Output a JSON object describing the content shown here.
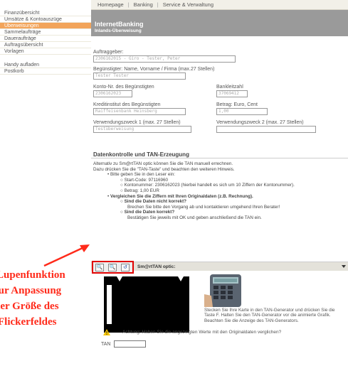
{
  "topnav": {
    "items": [
      "Homepage",
      "Banking",
      "Service & Verwaltung"
    ]
  },
  "sidebar": {
    "items": [
      "Finanzübersicht",
      "Umsätze & Kontoauszüge",
      "Überweisungen",
      "Sammelaufträge",
      "Daueraufträge",
      "Auftragsübersicht",
      "Vorlagen"
    ],
    "active_index": 2,
    "items2": [
      "Handy aufladen",
      "Postkorb"
    ]
  },
  "banner": {
    "title": "InternetBanking",
    "subtitle": "Inlands-Überweisung"
  },
  "form": {
    "auftraggeber": {
      "label": "Auftraggeber:",
      "value": "2306162015 - Giro - Tester, Peter"
    },
    "beguenstigter": {
      "label": "Begünstigter: Name, Vorname / Firma (max.27 Stellen)",
      "value": "Tester Tester"
    },
    "kontonr": {
      "label": "Konto-Nr. des Begünstigten",
      "value": "2306162023"
    },
    "bankleitzahl": {
      "label": "Bankleitzahl",
      "value": "37069412"
    },
    "kreditinstitut": {
      "label": "Kreditinstitut des Begünstigten",
      "value": "Raiffeisenbank Heinsberg"
    },
    "betrag": {
      "label": "Betrag: Euro, Cent",
      "value": "1,00"
    },
    "zweck1": {
      "label": "Verwendungszweck 1 (max. 27 Stellen)",
      "value": "Testüberweisung"
    },
    "zweck2": {
      "label": "Verwendungszweck 2 (max. 27 Stellen)",
      "value": ""
    }
  },
  "tan": {
    "heading": "Datenkontrolle und TAN-Erzeugung",
    "intro1": "Alternativ zu Sm@rtTAN optic können Sie die TAN manuell errechnen.",
    "intro2": "Dazu drücken Sie die \"TAN-Taste\" und beachten den weiteren Hinweis.",
    "step1": "Bitte geben Sie in den Leser ein:",
    "startcode": "Start-Code: 97116960",
    "kontonummer": "Kontonummer: 2306162023 (hierbei handelt es sich um 10 Ziffern der Kontonummer).",
    "betrag": "Betrag: 1,00 EUR",
    "step2": "Vergleichen Sie die Ziffern mit Ihren Originaldaten (z.B. Rechnung).",
    "q1": "Sind die Daten nicht korrekt?",
    "a1": "Brechen Sie bitte den Vorgang ab und kontaktieren umgehend Ihren Berater!",
    "q2": "Sind die Daten korrekt?",
    "a2": "Bestätigen Sie jeweils mit OK und geben anschließend die TAN ein."
  },
  "smarttan": {
    "title": "Sm@rtTAN optic:",
    "zoom_in": "🔍",
    "zoom_out": "🔍",
    "reset": "↺",
    "description": "Stecken Sie Ihre Karte in den TAN-Generator und drücken Sie die Taste F. Halten Sie den TAN-Generator vor die animierte Grafik. Beachten Sie die Anzeige des TAN-Generators."
  },
  "warning": {
    "text": "Achtung: Haben Sie die angezeigten Werte mit den Originaldaten verglichen?"
  },
  "tan_label": "TAN",
  "annotation": {
    "lines": [
      "Lupenfunktion",
      "zur Anpassung",
      "der Größe des",
      "Flickerfeldes"
    ]
  },
  "colors": {
    "accent": "#f2a45a",
    "annotation": "#ff2a1a",
    "banner": "#9a9a9a"
  }
}
